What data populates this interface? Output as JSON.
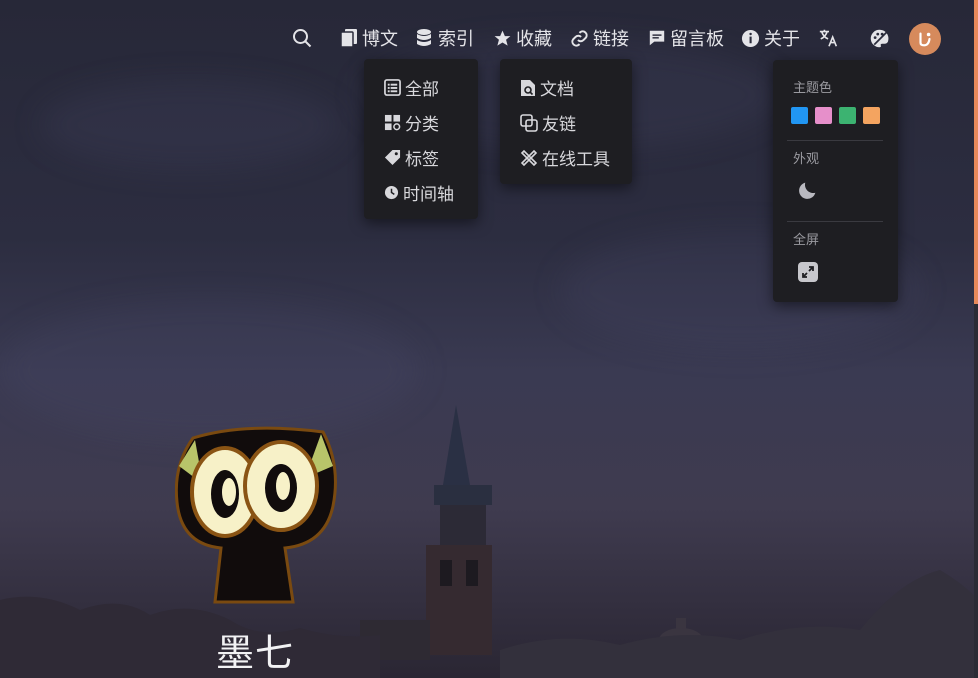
{
  "nav": {
    "posts": "博文",
    "index": "索引",
    "favorites": "收藏",
    "links": "链接",
    "guestbook": "留言板",
    "about": "关于"
  },
  "index_menu": {
    "all": "全部",
    "categories": "分类",
    "tags": "标签",
    "timeline": "时间轴"
  },
  "links_menu": {
    "docs": "文档",
    "friends": "友链",
    "tools": "在线工具"
  },
  "settings_panel": {
    "theme_color_title": "主题色",
    "appearance_title": "外观",
    "fullscreen_title": "全屏",
    "swatches": [
      "#2196f3",
      "#e68fca",
      "#3cb371",
      "#f4a460"
    ]
  },
  "author_name": "墨七",
  "icons": {
    "search": "search-icon",
    "posts": "documents-icon",
    "index": "database-icon",
    "favorites": "star-icon",
    "links": "link-icon",
    "guestbook": "comment-icon",
    "about": "info-icon",
    "translate": "translate-icon",
    "theme": "palette-icon"
  }
}
